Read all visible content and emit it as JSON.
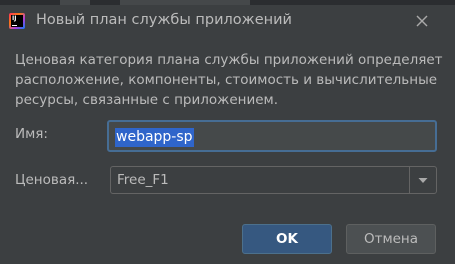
{
  "dialog": {
    "title": "Новый план службы приложений",
    "description": "Ценовая категория плана службы приложений определяет расположение, компоненты, стоимость и вычислительные ресурсы, связанные с приложением.",
    "app_icon_text": "IJ"
  },
  "form": {
    "name_label": "Имя:",
    "name_value": "webapp-sp",
    "pricing_label": "Ценовая...",
    "pricing_value": "Free_F1"
  },
  "buttons": {
    "ok": "OK",
    "cancel": "Отмена"
  },
  "colors": {
    "background": "#3c3f41",
    "primary_button": "#365880",
    "selection": "#2f65ca",
    "focus_border": "#466d94"
  },
  "icons": {
    "app": "intellij-idea-icon",
    "close": "close-icon",
    "dropdown": "chevron-down-icon"
  }
}
